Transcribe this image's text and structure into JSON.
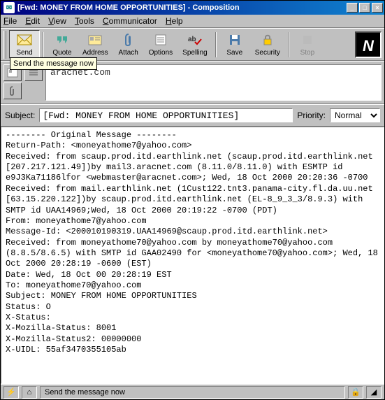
{
  "window": {
    "title": "[Fwd: MONEY FROM HOME OPPORTUNITIES] - Composition"
  },
  "menu": {
    "file": "File",
    "edit": "Edit",
    "view": "View",
    "tools": "Tools",
    "communicator": "Communicator",
    "help": "Help"
  },
  "toolbar": {
    "send": "Send",
    "quote": "Quote",
    "address": "Address",
    "attach": "Attach",
    "options": "Options",
    "spelling": "Spelling",
    "save": "Save",
    "security": "Security",
    "stop": "Stop"
  },
  "tooltip": "Send the message now",
  "address": {
    "to_value": "aracnet.com"
  },
  "subject": {
    "label": "Subject:",
    "value": "[Fwd: MONEY FROM HOME OPPORTUNITIES]",
    "priority_label": "Priority:",
    "priority_value": "Normal"
  },
  "body": "-------- Original Message --------\nReturn-Path: <moneyathome7@yahoo.com>\nReceived: from scaup.prod.itd.earthlink.net (scaup.prod.itd.earthlink.net [207.217.121.49])by mail3.aracnet.com (8.11.0/8.11.0) with ESMTP id e9J3Ka71186lfor <webmaster@aracnet.com>; Wed, 18 Oct 2000 20:20:36 -0700\nReceived: from mail.earthlink.net (1Cust122.tnt3.panama-city.fl.da.uu.net [63.15.220.122])by scaup.prod.itd.earthlink.net (EL-8_9_3_3/8.9.3) with SMTP id UAA14969;Wed, 18 Oct 2000 20:19:22 -0700 (PDT)\nFrom: moneyathome7@yahoo.com\nMessage-Id: <200010190319.UAA14969@scaup.prod.itd.earthlink.net>\nReceived: from moneyathome70@yahoo.com by moneyathome70@yahoo.com (8.8.5/8.6.5) with SMTP id GAA02490 for <moneyathome70@yahoo.com>; Wed, 18 Oct 2000 20:28:19 -0600 (EST)\nDate: Wed, 18 Oct 00 20:28:19 EST\nTo: moneyathome70@yahoo.com\nSubject: MONEY FROM HOME OPPORTUNITIES\nStatus: O\nX-Status:\nX-Mozilla-Status: 8001\nX-Mozilla-Status2: 00000000\nX-UIDL: 55af3470355105ab",
  "status": {
    "message": "Send the message now"
  }
}
